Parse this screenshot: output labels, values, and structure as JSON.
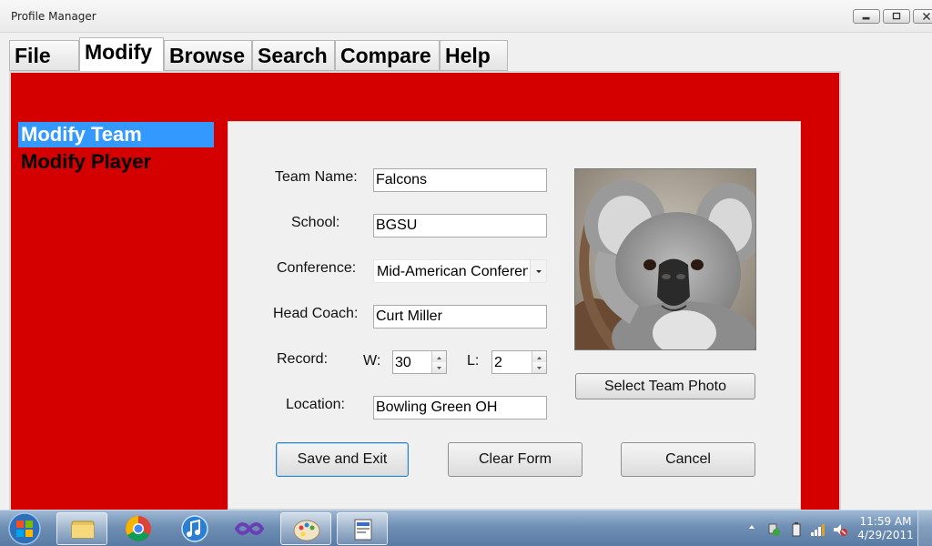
{
  "window": {
    "title": "Profile Manager"
  },
  "tabs": [
    {
      "label": "File"
    },
    {
      "label": "Modify"
    },
    {
      "label": "Browse"
    },
    {
      "label": "Search"
    },
    {
      "label": "Compare"
    },
    {
      "label": "Help"
    }
  ],
  "active_tab": "Modify",
  "sidebar": {
    "items": [
      {
        "label": "Modify Team",
        "selected": true
      },
      {
        "label": "Modify Player",
        "selected": false
      }
    ]
  },
  "form": {
    "team_name_label": "Team Name:",
    "team_name_value": "Falcons",
    "school_label": "School:",
    "school_value": "BGSU",
    "conference_label": "Conference:",
    "conference_value": "Mid-American Conferen",
    "head_coach_label": "Head Coach:",
    "head_coach_value": "Curt Miller",
    "record_label": "Record:",
    "wins_label": "W:",
    "wins_value": "30",
    "losses_label": "L:",
    "losses_value": "2",
    "location_label": "Location:",
    "location_value": "Bowling Green OH",
    "select_photo_label": "Select Team Photo",
    "photo_icon": "koala-photo"
  },
  "actions": {
    "save_label": "Save and Exit",
    "clear_label": "Clear Form",
    "cancel_label": "Cancel"
  },
  "taskbar": {
    "time": "11:59 AM",
    "date": "4/29/2011",
    "icons": [
      "start-orb-icon",
      "file-explorer-icon",
      "chrome-icon",
      "itunes-icon",
      "visual-studio-icon",
      "paint-icon",
      "app-window-icon"
    ]
  },
  "colors": {
    "panel_red": "#d40000",
    "selected_blue": "#3399ff"
  }
}
